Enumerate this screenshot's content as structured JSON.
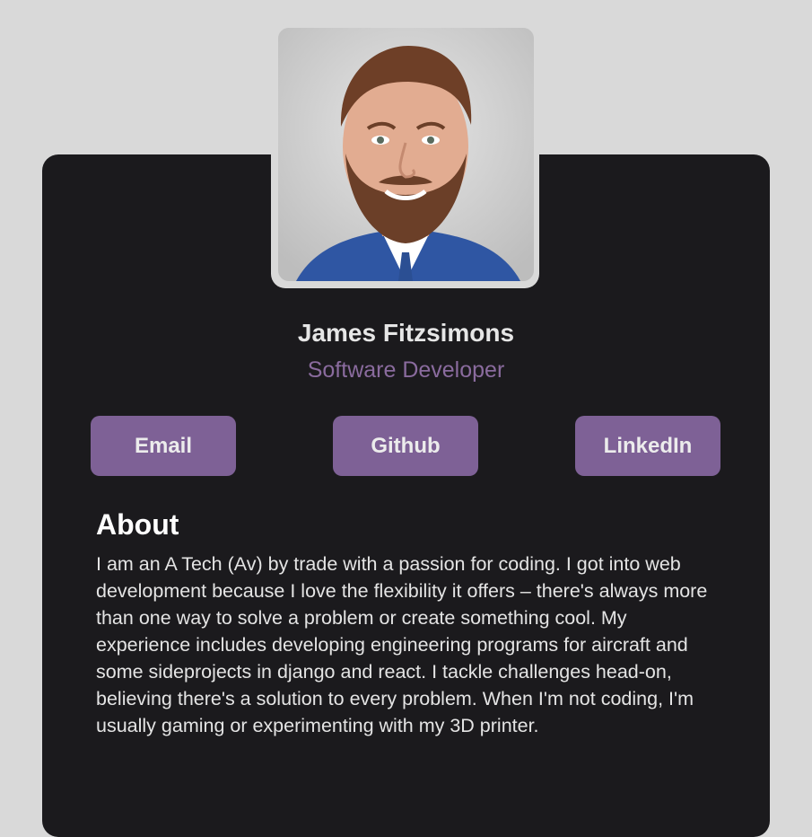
{
  "profile": {
    "name": "James Fitzsimons",
    "role": "Software Developer",
    "photo_alt": "headshot-photo"
  },
  "buttons": {
    "email": "Email",
    "github": "Github",
    "linkedin": "LinkedIn"
  },
  "about": {
    "title": "About",
    "text": "I am an A Tech (Av) by trade with a passion for coding. I got into web development because I love the flexibility it offers – there's always more than one way to solve a problem or create something cool. My experience includes developing engineering programs for aircraft and some sideprojects in django and react. I tackle challenges head-on, believing there's a solution to every problem. When I'm not coding, I'm usually gaming or experimenting with my 3D printer."
  },
  "colors": {
    "page_background": "#d9d9d9",
    "card_background": "#1b1a1d",
    "accent": "#7e6196",
    "role_text": "#8a6b9e"
  }
}
